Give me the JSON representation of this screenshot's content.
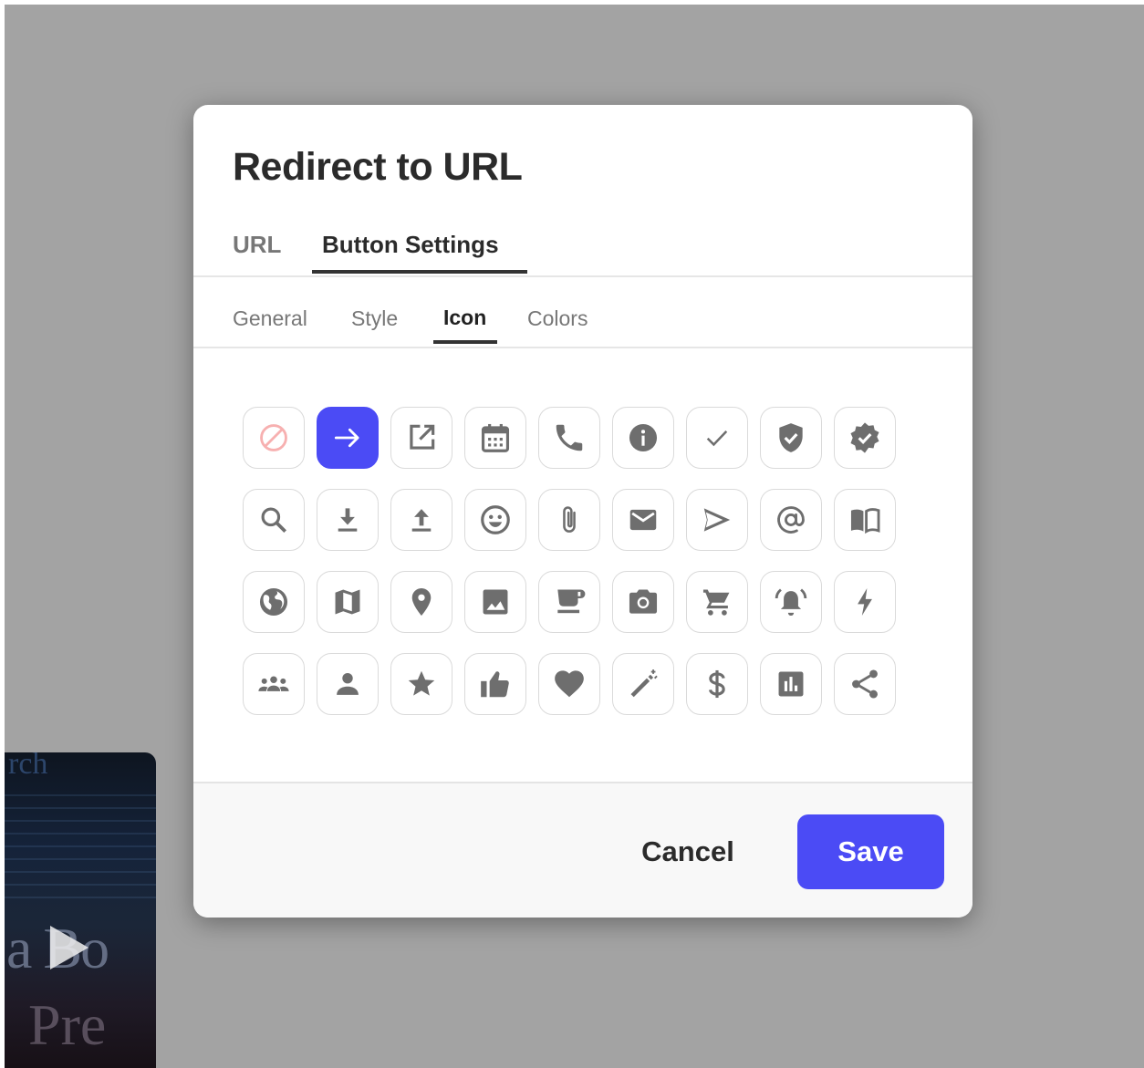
{
  "dialog": {
    "title": "Redirect to URL",
    "tabs": [
      {
        "label": "URL",
        "active": false
      },
      {
        "label": "Button Settings",
        "active": true
      }
    ],
    "subtabs": [
      {
        "label": "General",
        "active": false
      },
      {
        "label": "Style",
        "active": false
      },
      {
        "label": "Icon",
        "active": true
      },
      {
        "label": "Colors",
        "active": false
      }
    ],
    "icons": [
      [
        "ban-icon",
        "arrow-right-icon",
        "external-link-icon",
        "calendar-icon",
        "phone-icon",
        "info-icon",
        "check-icon",
        "shield-check-icon",
        "verified-badge-icon"
      ],
      [
        "search-icon",
        "download-icon",
        "upload-icon",
        "smiley-icon",
        "paperclip-icon",
        "mail-icon",
        "send-icon",
        "at-sign-icon",
        "book-icon"
      ],
      [
        "globe-icon",
        "map-icon",
        "location-pin-icon",
        "image-icon",
        "coffee-icon",
        "camera-icon",
        "shopping-cart-icon",
        "alarm-bell-icon",
        "lightning-icon"
      ],
      [
        "group-icon",
        "person-icon",
        "star-icon",
        "thumbs-up-icon",
        "heart-icon",
        "magic-wand-icon",
        "dollar-icon",
        "bar-chart-icon",
        "share-icon"
      ]
    ],
    "selected_icon": "arrow-right-icon",
    "footer": {
      "cancel_label": "Cancel",
      "save_label": "Save"
    }
  },
  "colors": {
    "accent": "#4b4bf5",
    "icon_gray": "#6e6e6e",
    "ban_red": "#f7b0b0",
    "overlay": "#a3a3a3"
  },
  "background_thumbnail": {
    "play_icon": "play-icon"
  }
}
